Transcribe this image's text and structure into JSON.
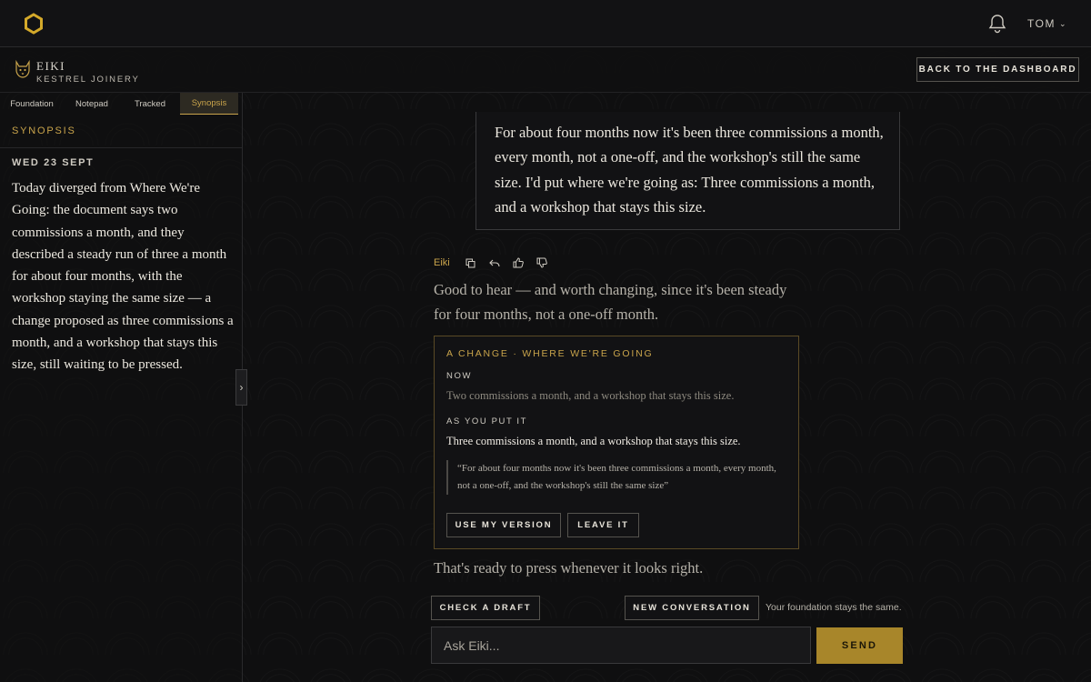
{
  "header": {
    "user": "TOM",
    "icons": {
      "logo": "hexagon-logo-icon",
      "bell": "bell-icon",
      "user_menu": "chevron-down-icon"
    }
  },
  "agent": {
    "name": "EIKI",
    "company": "KESTREL JOINERY",
    "icon": "cat-avatar-icon"
  },
  "back_button": "BACK TO THE DASHBOARD",
  "sidebar": {
    "tabs": [
      {
        "label": "Foundation"
      },
      {
        "label": "Notepad"
      },
      {
        "label": "Tracked"
      },
      {
        "label": "Synopsis"
      }
    ],
    "active_tab": "Synopsis",
    "section_title": "SYNOPSIS",
    "date": "WED 23 SEPT",
    "body": "Today diverged from Where We're Going: the document says two commissions a month, and they described a steady run of three a month for about four months, with the workshop staying the same size — a change proposed as three commissions a month, and a workshop that stays this size, still waiting to be pressed.",
    "collapse_icon": "chevron-right-icon"
  },
  "chat": {
    "user_message": "For about four months now it's been three commissions a month, every month, not a one-off, and the workshop's still the same size. I'd put where we're going as: Three commissions a month, and a workshop that stays this size.",
    "assistant_name": "Eiki",
    "message_actions": [
      "copy-icon",
      "reply-icon",
      "thumbs-up-icon",
      "thumbs-down-icon"
    ],
    "assistant_reply": "Good to hear — and worth changing, since it's been steady for four months, not a one-off month.",
    "change_card": {
      "heading": "A CHANGE · WHERE WE'RE GOING",
      "now_label": "NOW",
      "now_value": "Two commissions a month, and a workshop that stays this size.",
      "as_put_label": "AS YOU PUT IT",
      "as_put_value": "Three commissions a month, and a workshop that stays this size.",
      "quote": "“For about four months now it's been three commissions a month, every month, not a one-off, and the workshop's still the same size”",
      "use_button": "USE MY VERSION",
      "leave_button": "LEAVE IT"
    },
    "ready_text": "That's ready to press whenever it looks right."
  },
  "composer": {
    "check_draft": "CHECK A DRAFT",
    "new_conversation": "NEW CONVERSATION",
    "foundation_note": "Your foundation stays the same.",
    "placeholder": "Ask Eiki...",
    "send": "SEND"
  },
  "colors": {
    "accent": "#c9a44b",
    "send_bg": "#a8862a",
    "background": "#0f0f10"
  }
}
